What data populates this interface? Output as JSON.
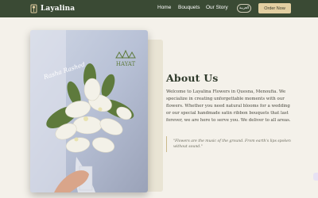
{
  "brand": {
    "name": "Layalina"
  },
  "nav": {
    "links": [
      "Home",
      "Bouquets",
      "Our Story"
    ],
    "lang_label": "العربية",
    "order_label": "Order Now"
  },
  "photo": {
    "script_text": "Rasha Rashed",
    "logo_text": "HAYAT"
  },
  "about": {
    "title": "About Us",
    "text": "Welcome to Layalina Flowers in Quesna, Menoufia. We specialize in creating unforgettable moments with our flowers. Whether you need natural blooms for a wedding or our special handmade satin ribbon bouquets that last forever, we are here to serve you. We deliver to all areas.",
    "quote": "\"Flowers are the music of the ground. From earth's lips spoken without sound.\""
  },
  "colors": {
    "navbar": "#3a4a34",
    "accent": "#e3cfa2",
    "background": "#f4f1ea",
    "title": "#2f3a2b"
  }
}
